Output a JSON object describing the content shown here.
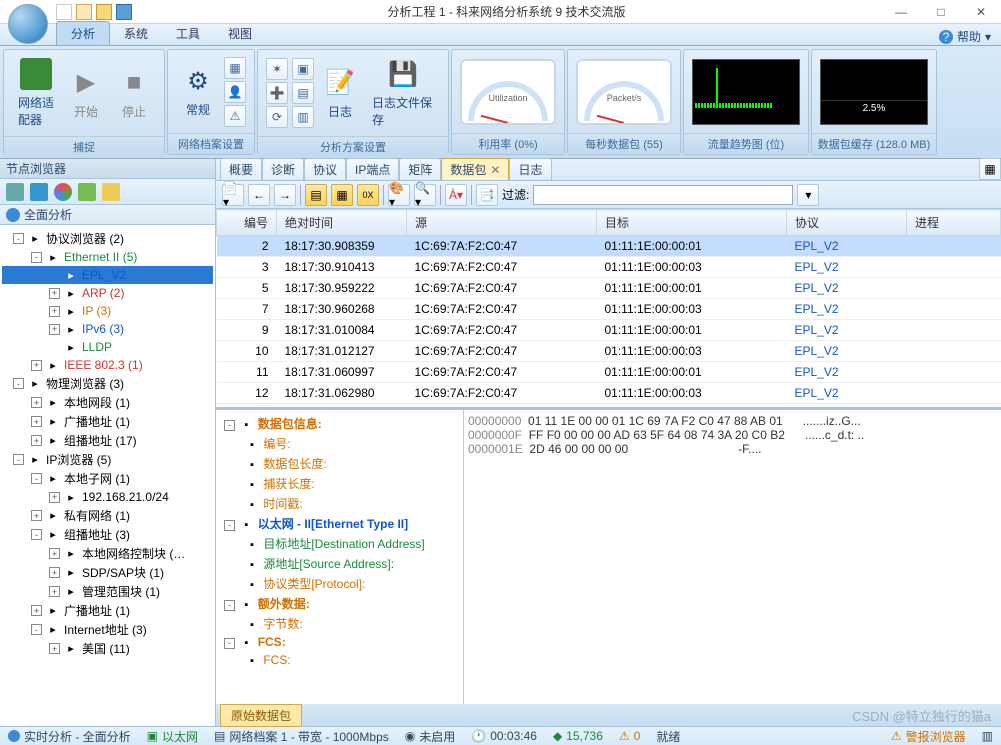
{
  "window": {
    "title": "分析工程 1 - 科来网络分析系统 9 技术交流版"
  },
  "ribbon_tabs": [
    "分析",
    "系统",
    "工具",
    "视图"
  ],
  "help_label": "帮助",
  "ribbon": {
    "capture": {
      "caption": "捕捉",
      "adapter": "网络适配器",
      "start": "开始",
      "stop": "停止"
    },
    "profile": {
      "caption": "网络档案设置",
      "general": "常规"
    },
    "scheme": {
      "caption": "分析方案设置",
      "log": "日志",
      "save_log": "日志文件保存"
    },
    "util": {
      "caption": "利用率 (0%)",
      "label": "Utilization"
    },
    "pps": {
      "caption": "每秒数据包 (55)",
      "label": "Packet/s"
    },
    "trend": {
      "caption": "流量趋势图 (位)"
    },
    "buf": {
      "caption": "数据包缓存 (128.0 MB)",
      "pct": "2.5%"
    }
  },
  "left": {
    "title": "节点浏览器",
    "full": "全面分析",
    "tree": [
      {
        "ind": 0,
        "exp": "-",
        "txt": "协议浏览器 (2)",
        "cls": ""
      },
      {
        "ind": 1,
        "exp": "-",
        "txt": "Ethernet II (5)",
        "cls": "green"
      },
      {
        "ind": 2,
        "exp": "",
        "txt": "EPL_V2",
        "cls": "blue",
        "sel": true
      },
      {
        "ind": 2,
        "exp": "+",
        "txt": "ARP (2)",
        "cls": "red"
      },
      {
        "ind": 2,
        "exp": "+",
        "txt": "IP (3)",
        "cls": "orange"
      },
      {
        "ind": 2,
        "exp": "+",
        "txt": "IPv6 (3)",
        "cls": "blue"
      },
      {
        "ind": 2,
        "exp": "",
        "txt": "LLDP",
        "cls": "green"
      },
      {
        "ind": 1,
        "exp": "+",
        "txt": "IEEE 802.3 (1)",
        "cls": "red"
      },
      {
        "ind": 0,
        "exp": "-",
        "txt": "物理浏览器 (3)",
        "cls": ""
      },
      {
        "ind": 1,
        "exp": "+",
        "txt": "本地网段 (1)",
        "cls": ""
      },
      {
        "ind": 1,
        "exp": "+",
        "txt": "广播地址 (1)",
        "cls": ""
      },
      {
        "ind": 1,
        "exp": "+",
        "txt": "组播地址 (17)",
        "cls": ""
      },
      {
        "ind": 0,
        "exp": "-",
        "txt": "IP浏览器 (5)",
        "cls": ""
      },
      {
        "ind": 1,
        "exp": "-",
        "txt": "本地子网 (1)",
        "cls": ""
      },
      {
        "ind": 2,
        "exp": "+",
        "txt": "192.168.21.0/24",
        "cls": ""
      },
      {
        "ind": 1,
        "exp": "+",
        "txt": "私有网络 (1)",
        "cls": ""
      },
      {
        "ind": 1,
        "exp": "-",
        "txt": "组播地址 (3)",
        "cls": ""
      },
      {
        "ind": 2,
        "exp": "+",
        "txt": "本地网络控制块 (…",
        "cls": ""
      },
      {
        "ind": 2,
        "exp": "+",
        "txt": "SDP/SAP块 (1)",
        "cls": ""
      },
      {
        "ind": 2,
        "exp": "+",
        "txt": "管理范围块 (1)",
        "cls": ""
      },
      {
        "ind": 1,
        "exp": "+",
        "txt": "广播地址 (1)",
        "cls": ""
      },
      {
        "ind": 1,
        "exp": "-",
        "txt": "Internet地址 (3)",
        "cls": ""
      },
      {
        "ind": 2,
        "exp": "+",
        "txt": "美国 (11)",
        "cls": ""
      }
    ]
  },
  "view_tabs": [
    {
      "label": "概要"
    },
    {
      "label": "诊断"
    },
    {
      "label": "协议"
    },
    {
      "label": "IP端点"
    },
    {
      "label": "矩阵"
    },
    {
      "label": "数据包",
      "active": true,
      "closable": true
    },
    {
      "label": "日志"
    }
  ],
  "filter_label": "过滤:",
  "columns": [
    "编号",
    "绝对时间",
    "源",
    "目标",
    "协议",
    "进程"
  ],
  "rows": [
    {
      "n": 2,
      "t": "18:17:30.908359",
      "s": "1C:69:7A:F2:C0:47",
      "d": "01:11:1E:00:00:01",
      "p": "EPL_V2",
      "sel": true
    },
    {
      "n": 3,
      "t": "18:17:30.910413",
      "s": "1C:69:7A:F2:C0:47",
      "d": "01:11:1E:00:00:03",
      "p": "EPL_V2"
    },
    {
      "n": 5,
      "t": "18:17:30.959222",
      "s": "1C:69:7A:F2:C0:47",
      "d": "01:11:1E:00:00:01",
      "p": "EPL_V2"
    },
    {
      "n": 7,
      "t": "18:17:30.960268",
      "s": "1C:69:7A:F2:C0:47",
      "d": "01:11:1E:00:00:03",
      "p": "EPL_V2"
    },
    {
      "n": 9,
      "t": "18:17:31.010084",
      "s": "1C:69:7A:F2:C0:47",
      "d": "01:11:1E:00:00:01",
      "p": "EPL_V2"
    },
    {
      "n": 10,
      "t": "18:17:31.012127",
      "s": "1C:69:7A:F2:C0:47",
      "d": "01:11:1E:00:00:03",
      "p": "EPL_V2"
    },
    {
      "n": 11,
      "t": "18:17:31.060997",
      "s": "1C:69:7A:F2:C0:47",
      "d": "01:11:1E:00:00:01",
      "p": "EPL_V2"
    },
    {
      "n": 12,
      "t": "18:17:31.062980",
      "s": "1C:69:7A:F2:C0:47",
      "d": "01:11:1E:00:00:03",
      "p": "EPL_V2"
    }
  ],
  "detail": [
    {
      "ind": 0,
      "exp": "-",
      "txt": "数据包信息:",
      "cls": "orange",
      "bold": true
    },
    {
      "ind": 1,
      "txt": "编号:",
      "cls": "orange"
    },
    {
      "ind": 1,
      "txt": "数据包长度:",
      "cls": "orange"
    },
    {
      "ind": 1,
      "txt": "捕获长度:",
      "cls": "orange"
    },
    {
      "ind": 1,
      "txt": "时间戳:",
      "cls": "orange"
    },
    {
      "ind": 0,
      "exp": "-",
      "txt": "以太网 - II[Ethernet Type II]",
      "cls": "blue",
      "bold": true
    },
    {
      "ind": 1,
      "txt": "目标地址[Destination Address]",
      "cls": "green"
    },
    {
      "ind": 1,
      "txt": "源地址[Source Address]:",
      "cls": "green"
    },
    {
      "ind": 1,
      "txt": "协议类型[Protocol]:",
      "cls": "orange"
    },
    {
      "ind": 0,
      "exp": "-",
      "txt": "额外数据:",
      "cls": "orange",
      "bold": true
    },
    {
      "ind": 1,
      "txt": "字节数:",
      "cls": "orange"
    },
    {
      "ind": 0,
      "exp": "-",
      "txt": "FCS:",
      "cls": "orange",
      "bold": true
    },
    {
      "ind": 1,
      "txt": "FCS:",
      "cls": "orange"
    }
  ],
  "hex": [
    {
      "a": "00000000",
      "h": "01 11 1E 00 00 01 1C 69 7A F2 C0 47 88 AB 01",
      "t": ".......iz..G..."
    },
    {
      "a": "0000000F",
      "h": "FF F0 00 00 00 AD 63 5F 64 08 74 3A 20 C0 B2",
      "t": "......c_d.t: .."
    },
    {
      "a": "0000001E",
      "h": "2D 46 00 00 00 00",
      "t": "-F...."
    }
  ],
  "bottom_tab": "原始数据包",
  "status": {
    "s1": "实时分析 - 全面分析",
    "s2": "以太网",
    "s3": "网络档案 1 - 带宽 - 1000Mbps",
    "s4": "未启用",
    "t": "00:03:46",
    "p": "15,736",
    "w": "0",
    "r": "就绪",
    "a": "警报浏览器"
  },
  "watermark": "CSDN @特立独行的猫a"
}
